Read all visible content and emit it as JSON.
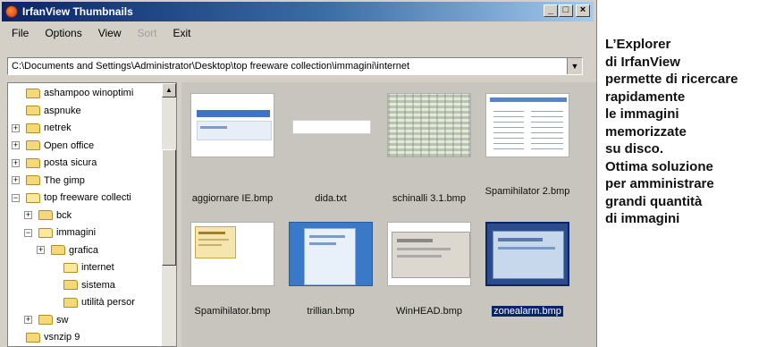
{
  "window": {
    "title": "IrfanView Thumbnails",
    "buttons": {
      "minimize": "_",
      "maximize": "□",
      "close": "×"
    }
  },
  "menu": [
    "File",
    "Options",
    "View",
    "Sort",
    "Exit"
  ],
  "path": "C:\\Documents and Settings\\Administrator\\Desktop\\top freeware collection\\immagini\\internet",
  "tree": [
    {
      "label": "ashampoo winoptimi",
      "expander": ""
    },
    {
      "label": "aspnuke",
      "expander": ""
    },
    {
      "label": "netrek",
      "expander": "+"
    },
    {
      "label": "Open office",
      "expander": "+"
    },
    {
      "label": "posta sicura",
      "expander": "+"
    },
    {
      "label": "The gimp",
      "expander": "+"
    },
    {
      "label": "top freeware collecti",
      "expander": "−"
    },
    {
      "label": "bck",
      "expander": "+"
    },
    {
      "label": "immagini",
      "expander": "−"
    },
    {
      "label": "grafica",
      "expander": "+"
    },
    {
      "label": "internet",
      "expander": ""
    },
    {
      "label": "sistema",
      "expander": ""
    },
    {
      "label": "utilità persor",
      "expander": ""
    },
    {
      "label": "sw",
      "expander": "+"
    },
    {
      "label": "vsnzip 9",
      "expander": ""
    }
  ],
  "thumbnails": [
    {
      "name": "aggiornare IE.bmp",
      "selected": false
    },
    {
      "name": "dida.txt",
      "selected": false
    },
    {
      "name": "schinalli 3.1.bmp",
      "selected": false
    },
    {
      "name": "Spamihilator 2.bmp",
      "selected": false
    },
    {
      "name": "Spamihilator.bmp",
      "selected": false
    },
    {
      "name": "trillian.bmp",
      "selected": false
    },
    {
      "name": "WinHEAD.bmp",
      "selected": false
    },
    {
      "name": "zonealarm.bmp",
      "selected": true
    }
  ],
  "caption": [
    "L’Explorer",
    "di IrfanView",
    "permette di ricercare",
    "rapidamente",
    "le immagini",
    "memorizzate",
    "su disco.",
    "Ottima soluzione",
    "per amministrare",
    "grandi quantità",
    "di immagini"
  ],
  "colors": {
    "title_bar": "#0a246a",
    "window": "#d4d0c8",
    "selection": "#0a246a"
  }
}
